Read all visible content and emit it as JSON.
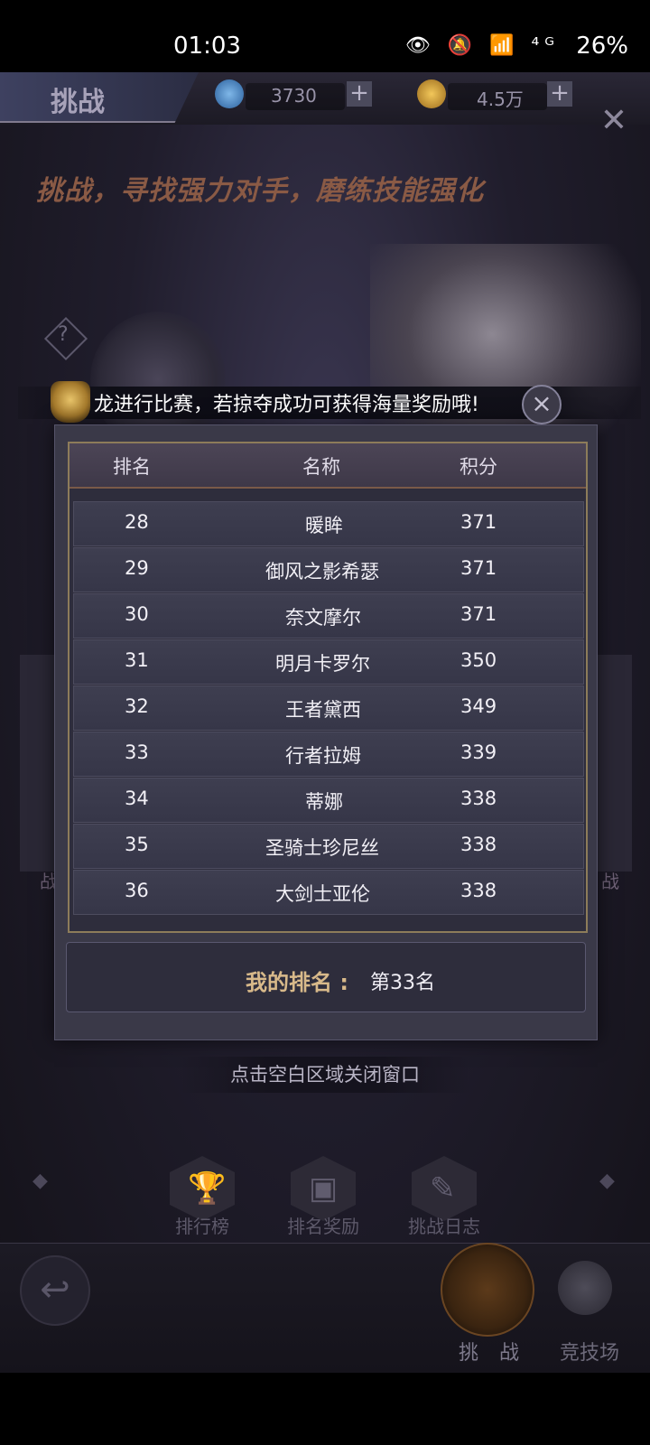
{
  "status_bar": {
    "time": "01:03",
    "icons": "👁 🔕 📶 ⁴ᴳ",
    "battery": "26%"
  },
  "top_bar": {
    "title": "挑战",
    "diamonds": "3730",
    "gold": "4.5万",
    "plus": "+"
  },
  "slogan": "挑战，寻找强力对手，磨练技能强化",
  "banner": {
    "text": "龙进行比赛，若掠夺成功可获得海量奖励哦!",
    "close": "×"
  },
  "ranking": {
    "headers": {
      "rank": "排名",
      "name": "名称",
      "score": "积分"
    },
    "rows": [
      {
        "rank": "28",
        "name": "暖眸",
        "score": "371"
      },
      {
        "rank": "29",
        "name": "御风之影希瑟",
        "score": "371"
      },
      {
        "rank": "30",
        "name": "奈文摩尔",
        "score": "371"
      },
      {
        "rank": "31",
        "name": "明月卡罗尔",
        "score": "350"
      },
      {
        "rank": "32",
        "name": "王者黛西",
        "score": "349"
      },
      {
        "rank": "33",
        "name": "行者拉姆",
        "score": "339"
      },
      {
        "rank": "34",
        "name": "蒂娜",
        "score": "338"
      },
      {
        "rank": "35",
        "name": "圣骑士珍尼丝",
        "score": "338"
      },
      {
        "rank": "36",
        "name": "大剑士亚伦",
        "score": "338"
      }
    ],
    "my_rank_label": "我的排名 :",
    "my_rank_value": "第33名"
  },
  "close_hint": "点击空白区域关闭窗口",
  "side_labels": {
    "left": "战",
    "right": "战"
  },
  "bottom_menu": [
    {
      "label": "排行榜",
      "icon": "🏆"
    },
    {
      "label": "排名奖励",
      "icon": "▣"
    },
    {
      "label": "挑战日志",
      "icon": "✎"
    }
  ],
  "nav": {
    "back": "↩",
    "challenge": "挑 战",
    "arena": "竞技场"
  }
}
